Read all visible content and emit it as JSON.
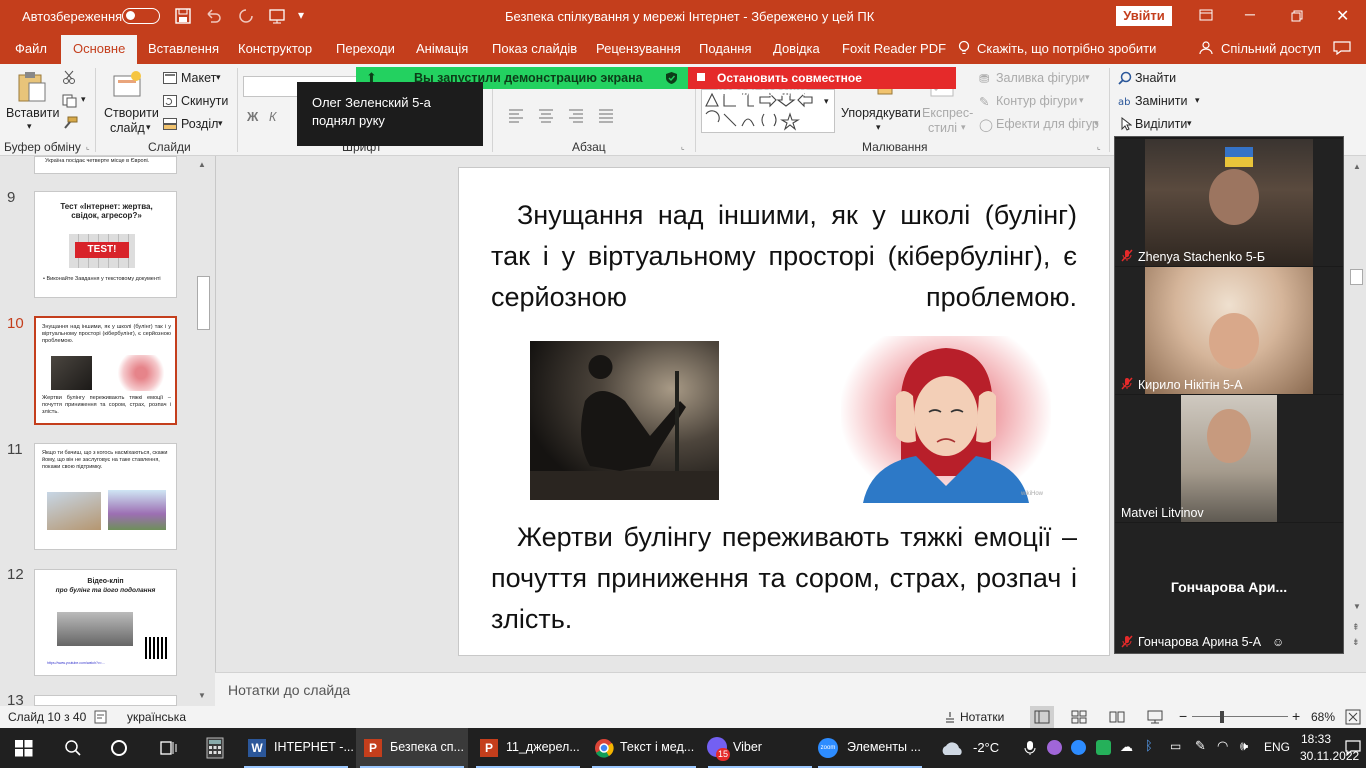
{
  "titlebar": {
    "autosave": "Автозбереження",
    "title": "Безпека спілкування у мережі Інтернет  -  Збережено у цей ПК",
    "signin": "Увійти"
  },
  "tabs": [
    {
      "label": "Файл"
    },
    {
      "label": "Основне"
    },
    {
      "label": "Вставлення"
    },
    {
      "label": "Конструктор"
    },
    {
      "label": "Переходи"
    },
    {
      "label": "Анімація"
    },
    {
      "label": "Показ слайдів"
    },
    {
      "label": "Рецензування"
    },
    {
      "label": "Подання"
    },
    {
      "label": "Довідка"
    },
    {
      "label": "Foxit Reader PDF"
    },
    {
      "label": "Скажіть, що потрібно зробити"
    }
  ],
  "share": "Спільний доступ",
  "ribbon": {
    "paste": "Вставити",
    "new_slide_1": "Створити",
    "new_slide_2": "слайд",
    "layout": "Макет",
    "reset": "Скинути",
    "section": "Розділ",
    "clipboard": "Буфер обміну",
    "slides": "Слайди",
    "font": "Шрифт",
    "paragraph": "Абзац",
    "drawing": "Малювання",
    "arrange": "Упорядкувати",
    "quick_styles_1": "Експрес-",
    "quick_styles_2": "стилі",
    "shape_fill": "Заливка фігури",
    "shape_outline": "Контур фігури",
    "shape_effects": "Ефекти для фігур",
    "find": "Знайти",
    "replace": "Замінити",
    "select": "Виділити"
  },
  "zoom_share": {
    "running": "Вы запустили демонстрацию экрана",
    "stop": "Остановить совместное использование"
  },
  "tooltip": {
    "line1": "Олег Зеленский 5-а",
    "line2": "поднял руку"
  },
  "thumbs": [
    {
      "num": "",
      "text": "Україна посідає четверте місце в Європі."
    },
    {
      "num": "9",
      "title": "Тест «Інтернет: жертва, свідок, агресор?»",
      "badge": "TEST!",
      "bullet": "• Виконайте Завдання  у текстовому документі"
    },
    {
      "num": "10",
      "top": "Знущання над іншими, як у школі (булінг) так і у віртуальному просторі (кібербулінг), є серйозною проблемою.",
      "bottom": "Жертви булінгу переживають тяжкі емоції – почуття приниження та сором, страх, розпач і злість."
    },
    {
      "num": "11",
      "text": "Якщо ти бачиш, що з когось насміхаються, скажи йому, що він не заслуговує на таке ставлення, покажи свою підтримку."
    },
    {
      "num": "12",
      "title": "Відео-кліп",
      "subtitle": "про булінг та його подолання",
      "link": "https://www.youtube.com/watch?v=..."
    },
    {
      "num": "13"
    }
  ],
  "slide": {
    "text_top": "Знущання над іншими, як у школі (булінг) так і у віртуальному просторі (кібербулінг), є серйозною проблемою.",
    "text_bottom": "Жертви булінгу переживають тяжкі емоції – почуття приниження та сором, страх, розпач і злість.",
    "wikihow": "wikiHow"
  },
  "participants": [
    {
      "name": "Zhenya Stachenko 5-Б",
      "muted": true
    },
    {
      "name": "Кирило Нікітін 5-А",
      "muted": true
    },
    {
      "name": "Matvei Litvinov",
      "muted": false
    },
    {
      "name": "Гончарова Арина 5-А",
      "muted": true,
      "big": "Гончарова  Ари..."
    }
  ],
  "notes": "Нотатки до слайда",
  "status": {
    "slide": "Слайд 10 з 40",
    "lang": "українська",
    "notes": "Нотатки",
    "zoom": "68%"
  },
  "taskbar": {
    "apps": [
      {
        "label": "ІНТЕРНЕТ -..."
      },
      {
        "label": "Безпека сп..."
      },
      {
        "label": "11_джерел..."
      },
      {
        "label": "Текст і мед..."
      },
      {
        "label": "Viber",
        "badge": "15"
      },
      {
        "label": "Элементы ..."
      }
    ],
    "zoom_logo": "zoom",
    "weather": "-2°C",
    "lang": "ENG",
    "time": "18:33",
    "date": "30.11.2022"
  },
  "colors": {
    "accent": "#c43e1c",
    "zoom_green": "#23d160",
    "zoom_red": "#e52a2a"
  }
}
